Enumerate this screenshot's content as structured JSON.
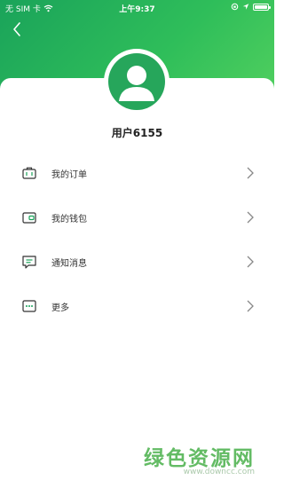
{
  "status_bar": {
    "carrier": "无 SIM 卡",
    "time": "上午9:37"
  },
  "profile": {
    "username": "用户6155"
  },
  "menu": [
    {
      "label": "我的订单",
      "icon": "briefcase-icon"
    },
    {
      "label": "我的钱包",
      "icon": "wallet-icon"
    },
    {
      "label": "通知消息",
      "icon": "message-icon"
    },
    {
      "label": "更多",
      "icon": "more-icon"
    }
  ],
  "watermark": {
    "title": "绿色资源网",
    "url": "www.downcc.com"
  },
  "colors": {
    "brand_green": "#26a65b",
    "header_gradient_start": "#1aa35a",
    "header_gradient_end": "#56d25f"
  }
}
